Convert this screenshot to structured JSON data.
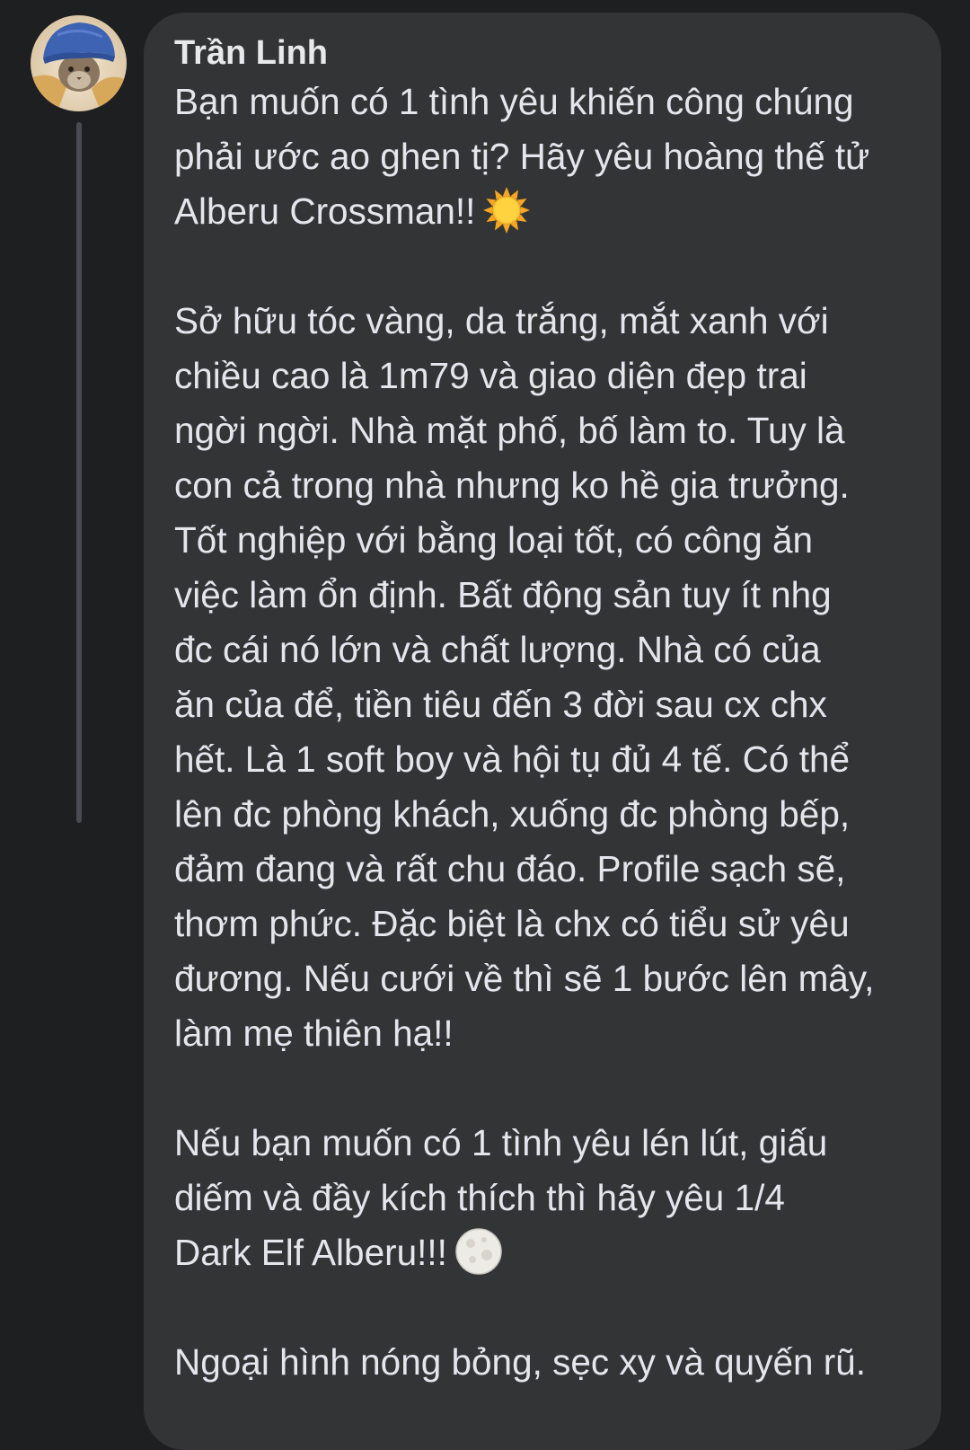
{
  "comment": {
    "author": "Trần Linh",
    "lines": [
      {
        "text": "Bạn muốn có 1 tình yêu khiến công chúng"
      },
      {
        "text": "phải ước ao ghen tị? Hãy yêu hoàng thế tử"
      },
      {
        "text": "Alberu Crossman!!",
        "emoji": "sun-emoji"
      },
      {
        "text": ""
      },
      {
        "text": "Sở hữu tóc vàng, da trắng, mắt xanh với"
      },
      {
        "text": "chiều cao là 1m79 và giao diện đẹp trai"
      },
      {
        "text": "ngời ngời. Nhà mặt phố, bố làm to. Tuy là"
      },
      {
        "text": "con cả trong nhà nhưng ko hề gia trưởng."
      },
      {
        "text": "Tốt nghiệp với bằng loại tốt, có công ăn"
      },
      {
        "text": "việc làm ổn định. Bất động sản tuy ít nhg"
      },
      {
        "text": "đc cái nó lớn và chất lượng. Nhà có của"
      },
      {
        "text": "ăn của để, tiền tiêu đến 3 đời sau cx chx"
      },
      {
        "text": "hết. Là 1 soft boy và hội tụ đủ 4 tế. Có thể"
      },
      {
        "text": "lên đc phòng khách, xuống đc phòng bếp,"
      },
      {
        "text": "đảm đang và rất chu đáo. Profile sạch sẽ,"
      },
      {
        "text": "thơm phức. Đặc biệt là chx có tiểu sử yêu"
      },
      {
        "text": "đương. Nếu cưới về thì sẽ 1 bước lên mây,"
      },
      {
        "text": "làm mẹ thiên hạ!!"
      },
      {
        "text": ""
      },
      {
        "text": "Nếu bạn muốn có 1 tình yêu lén lút, giấu"
      },
      {
        "text": "diếm và đầy kích thích thì hãy yêu 1/4"
      },
      {
        "text": "Dark Elf Alberu!!!",
        "emoji": "full-moon-emoji"
      },
      {
        "text": ""
      },
      {
        "text": "Ngoại hình nóng bỏng, sẹc xy và quyến rũ."
      }
    ]
  },
  "colors": {
    "background": "#1e1f21",
    "bubble": "#333436",
    "text": "#e4e6eb",
    "thread_line": "#4a4b4e"
  }
}
